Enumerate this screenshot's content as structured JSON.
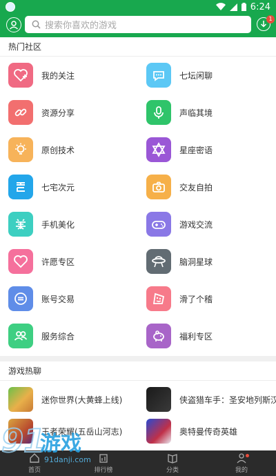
{
  "status_bar": {
    "time": "6:24"
  },
  "header": {
    "search_placeholder": "搜索你喜欢的游戏",
    "download_badge": "1"
  },
  "hot_community": {
    "title": "热门社区",
    "items": [
      {
        "label": "我的关注",
        "icon": "heart-plus-icon",
        "color": "#f06a83"
      },
      {
        "label": "七坛闲聊",
        "icon": "chat-bubble-icon",
        "color": "#5cc8f5"
      },
      {
        "label": "资源分享",
        "icon": "link-icon",
        "color": "#f26f6f"
      },
      {
        "label": "声临其境",
        "icon": "microphone-icon",
        "color": "#2fc46a"
      },
      {
        "label": "原创技术",
        "icon": "lightbulb-icon",
        "color": "#f7b35a"
      },
      {
        "label": "星座密语",
        "icon": "star-of-david-icon",
        "color": "#9a57d6"
      },
      {
        "label": "七宅次元",
        "icon": "otaku-icon",
        "color": "#23a6ea"
      },
      {
        "label": "交友自拍",
        "icon": "camera-icon",
        "color": "#f6b049"
      },
      {
        "label": "手机美化",
        "icon": "beautify-icon",
        "color": "#3dcfc1"
      },
      {
        "label": "游戏交流",
        "icon": "gamepad-icon",
        "color": "#8a78e6"
      },
      {
        "label": "许愿专区",
        "icon": "heart-icon",
        "color": "#f5709c"
      },
      {
        "label": "脑洞星球",
        "icon": "ufo-icon",
        "color": "#626c73"
      },
      {
        "label": "账号交易",
        "icon": "exchange-icon",
        "color": "#5f8de8"
      },
      {
        "label": "滑了个稽",
        "icon": "funny-face-icon",
        "color": "#f77a8a"
      },
      {
        "label": "服务综合",
        "icon": "users-icon",
        "color": "#3ecf82"
      },
      {
        "label": "福利专区",
        "icon": "piggy-bank-icon",
        "color": "#a865c8"
      }
    ]
  },
  "game_chat": {
    "title": "游戏热聊",
    "items": [
      {
        "label": "迷你世界(大黄蜂上线)",
        "icon": "mini-world-game-icon"
      },
      {
        "label": "侠盗猎车手：圣安地列斯汉",
        "icon": "gta-game-icon"
      },
      {
        "label": "王者荣耀(五岳山河志)",
        "icon": "honor-of-kings-game-icon"
      },
      {
        "label": "奥特曼传奇英雄",
        "icon": "ultraman-game-icon"
      }
    ]
  },
  "bottom_nav": [
    {
      "label": "首页",
      "icon": "home-icon"
    },
    {
      "label": "排行榜",
      "icon": "ranking-icon"
    },
    {
      "label": "分类",
      "icon": "category-icon"
    },
    {
      "label": "我的",
      "icon": "profile-icon"
    }
  ],
  "watermark": {
    "brand": "游戏",
    "logo_number": "91",
    "url": "91danji.com"
  }
}
